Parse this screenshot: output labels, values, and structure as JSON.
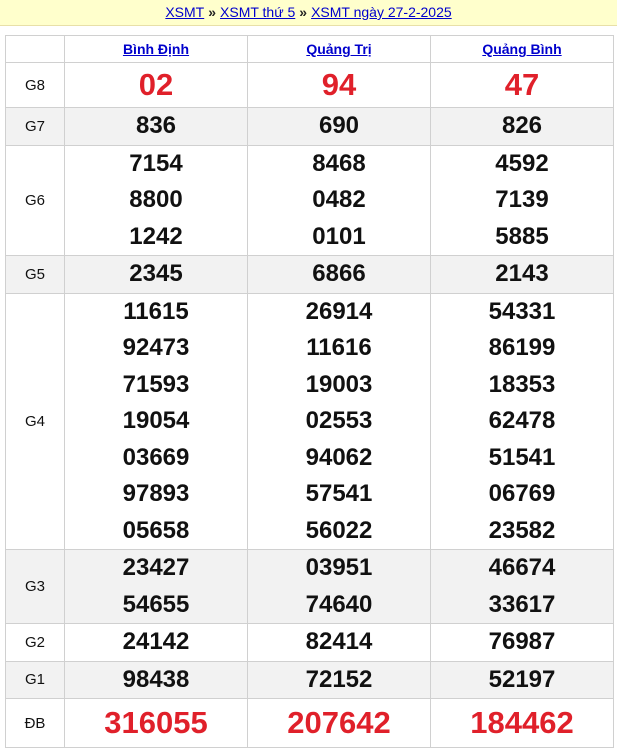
{
  "breadcrumb": {
    "items": [
      "XSMT",
      "XSMT thứ 5",
      "XSMT ngày 27-2-2025"
    ],
    "separator": "»"
  },
  "provinces": [
    "Bình Định",
    "Quảng Trị",
    "Quảng Bình"
  ],
  "prizes": [
    {
      "label": "G8",
      "values": [
        [
          "02"
        ],
        [
          "94"
        ],
        [
          "47"
        ]
      ]
    },
    {
      "label": "G7",
      "values": [
        [
          "836"
        ],
        [
          "690"
        ],
        [
          "826"
        ]
      ]
    },
    {
      "label": "G6",
      "values": [
        [
          "7154",
          "8800",
          "1242"
        ],
        [
          "8468",
          "0482",
          "0101"
        ],
        [
          "4592",
          "7139",
          "5885"
        ]
      ]
    },
    {
      "label": "G5",
      "values": [
        [
          "2345"
        ],
        [
          "6866"
        ],
        [
          "2143"
        ]
      ]
    },
    {
      "label": "G4",
      "values": [
        [
          "11615",
          "92473",
          "71593",
          "19054",
          "03669",
          "97893",
          "05658"
        ],
        [
          "26914",
          "11616",
          "19003",
          "02553",
          "94062",
          "57541",
          "56022"
        ],
        [
          "54331",
          "86199",
          "18353",
          "62478",
          "51541",
          "06769",
          "23582"
        ]
      ]
    },
    {
      "label": "G3",
      "values": [
        [
          "23427",
          "54655"
        ],
        [
          "03951",
          "74640"
        ],
        [
          "46674",
          "33617"
        ]
      ]
    },
    {
      "label": "G2",
      "values": [
        [
          "24142"
        ],
        [
          "82414"
        ],
        [
          "76987"
        ]
      ]
    },
    {
      "label": "G1",
      "values": [
        [
          "98438"
        ],
        [
          "72152"
        ],
        [
          "52197"
        ]
      ]
    },
    {
      "label": "ĐB",
      "values": [
        [
          "316055"
        ],
        [
          "207642"
        ],
        [
          "184462"
        ]
      ]
    }
  ],
  "colors": {
    "highlight": "#e0202a",
    "link": "#0000cc",
    "stripe": "#f2f2f2",
    "banner": "#ffffcc"
  }
}
